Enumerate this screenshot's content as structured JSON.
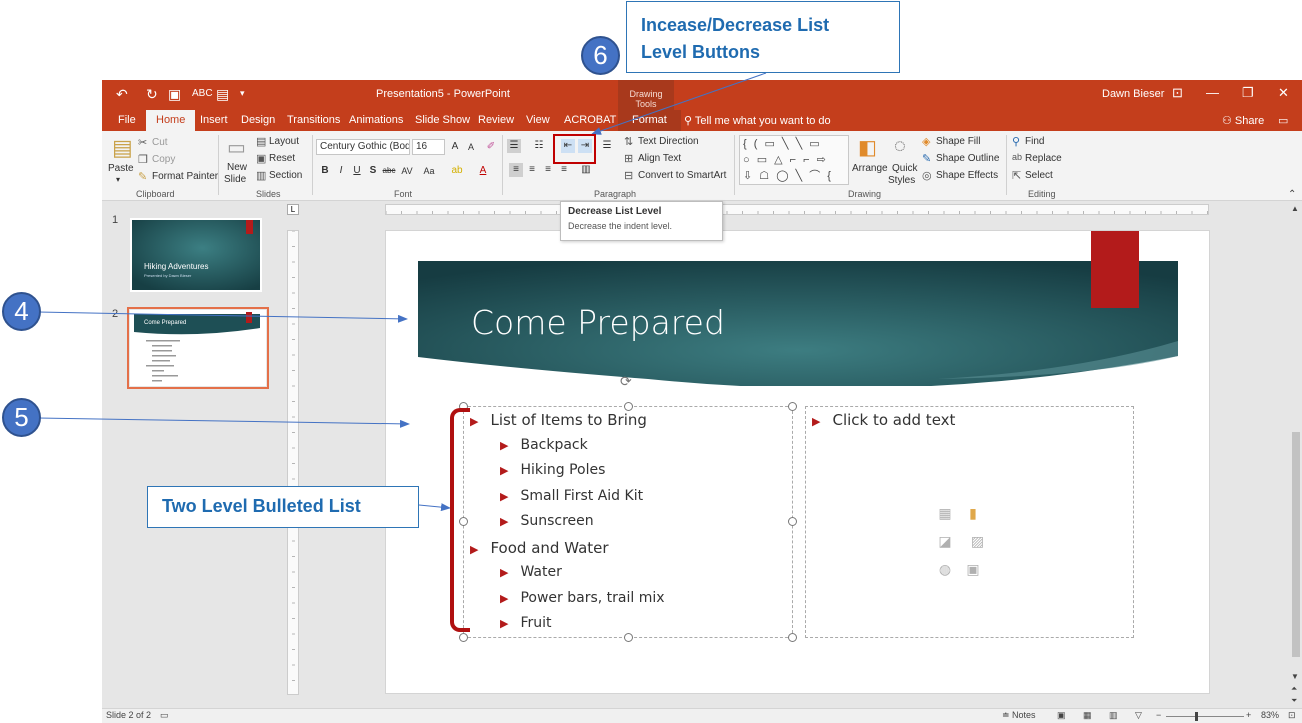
{
  "window": {
    "title": "Presentation5 - PowerPoint",
    "context_group": "Drawing Tools",
    "user": "Dawn Bieser"
  },
  "tabs": [
    {
      "label": "File"
    },
    {
      "label": "Home"
    },
    {
      "label": "Insert"
    },
    {
      "label": "Design"
    },
    {
      "label": "Transitions"
    },
    {
      "label": "Animations"
    },
    {
      "label": "Slide Show"
    },
    {
      "label": "Review"
    },
    {
      "label": "View"
    },
    {
      "label": "ACROBAT"
    },
    {
      "label": "Format"
    }
  ],
  "tell_me": "Tell me what you want to do",
  "share": "Share",
  "ribbon": {
    "clipboard": {
      "paste": "Paste",
      "cut": "Cut",
      "copy": "Copy",
      "format_painter": "Format Painter",
      "label": "Clipboard"
    },
    "slides": {
      "new_slide": "New",
      "new_slide2": "Slide",
      "layout": "Layout",
      "reset": "Reset",
      "section": "Section",
      "label": "Slides"
    },
    "font": {
      "name": "Century Gothic (Bod",
      "size": "16",
      "label": "Font"
    },
    "paragraph": {
      "text_direction": "Text Direction",
      "align_text": "Align Text",
      "convert_smartart": "Convert to SmartArt",
      "label": "Paragraph"
    },
    "drawing": {
      "arrange": "Arrange",
      "quick_styles": "Quick",
      "quick_styles2": "Styles",
      "shape_fill": "Shape Fill",
      "shape_outline": "Shape Outline",
      "shape_effects": "Shape Effects",
      "label": "Drawing"
    },
    "editing": {
      "find": "Find",
      "replace": "Replace",
      "select": "Select",
      "label": "Editing"
    }
  },
  "tooltip": {
    "title": "Decrease List Level",
    "description": "Decrease the indent level."
  },
  "thumbnails": [
    {
      "number": "1",
      "title": "Hiking Adventures",
      "subtitle": "Presented by Dawn Bieser"
    },
    {
      "number": "2",
      "title": "Come Prepared"
    }
  ],
  "slide": {
    "title": "Come Prepared",
    "bullets": [
      {
        "level": 1,
        "text": "List of Items to Bring"
      },
      {
        "level": 2,
        "text": "Backpack"
      },
      {
        "level": 2,
        "text": "Hiking Poles"
      },
      {
        "level": 2,
        "text": "Small First Aid Kit"
      },
      {
        "level": 2,
        "text": "Sunscreen"
      },
      {
        "level": 1,
        "text": "Food and Water"
      },
      {
        "level": 2,
        "text": "Water"
      },
      {
        "level": 2,
        "text": "Power bars, trail mix"
      },
      {
        "level": 2,
        "text": "Fruit"
      }
    ],
    "right_placeholder": "Click to add text"
  },
  "status": {
    "slide": "Slide 2 of 2",
    "notes": "Notes",
    "zoom": "83%"
  },
  "annotations": {
    "badge_4": "4",
    "badge_5": "5",
    "badge_6": "6",
    "callout_top_line1": "Incease/Decrease List",
    "callout_top_line2": "Level Buttons",
    "callout_list": "Two Level Bulleted List"
  },
  "colors": {
    "brand": "#c43e1c",
    "accent_red": "#b31b1b",
    "annotation_blue": "#4472c4",
    "slide_teal": "#1e4f55"
  }
}
